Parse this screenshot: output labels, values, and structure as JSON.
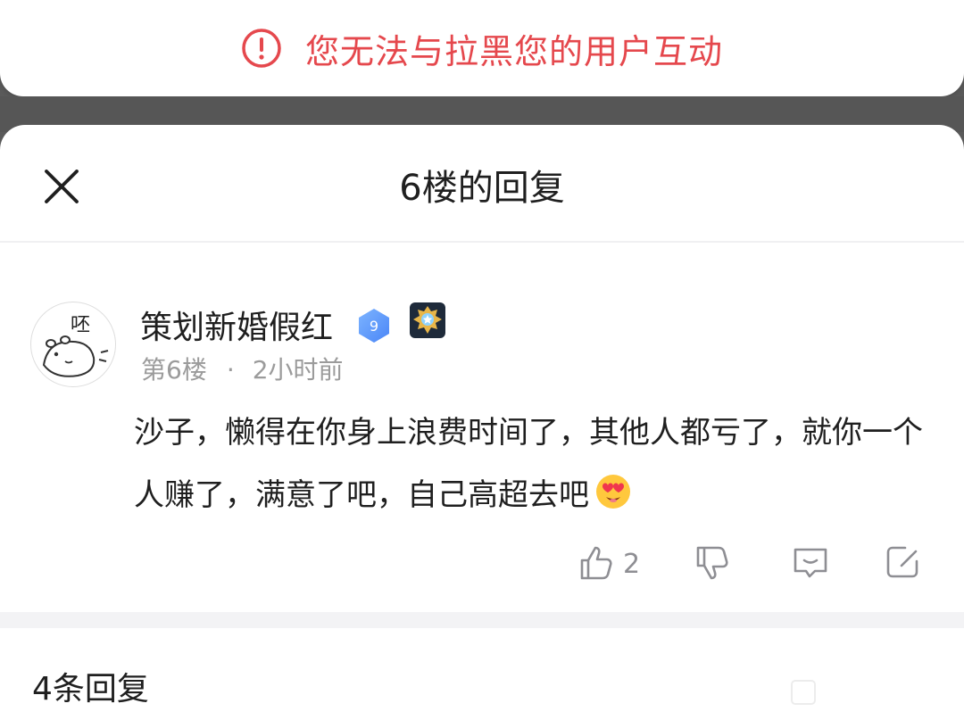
{
  "toast": {
    "icon": "alert-circle-icon",
    "message": "您无法与拉黑您的用户互动",
    "color": "#e5484d"
  },
  "sheet": {
    "title": "6楼的回复",
    "close_icon": "close-icon"
  },
  "post": {
    "avatar_text": "呸",
    "username": "策划新婚假红",
    "level": "9",
    "medal_icon": "medal-icon",
    "floor": "第6楼",
    "separator": "·",
    "time": "2小时前",
    "content": "沙子，懒得在你身上浪费时间了，其他人都亏了，就你一个人赚了，满意了吧，自己高超去吧",
    "emoji": "heart-eyes-emoji",
    "likes": "2"
  },
  "replies": {
    "count_label": "4条回复"
  }
}
